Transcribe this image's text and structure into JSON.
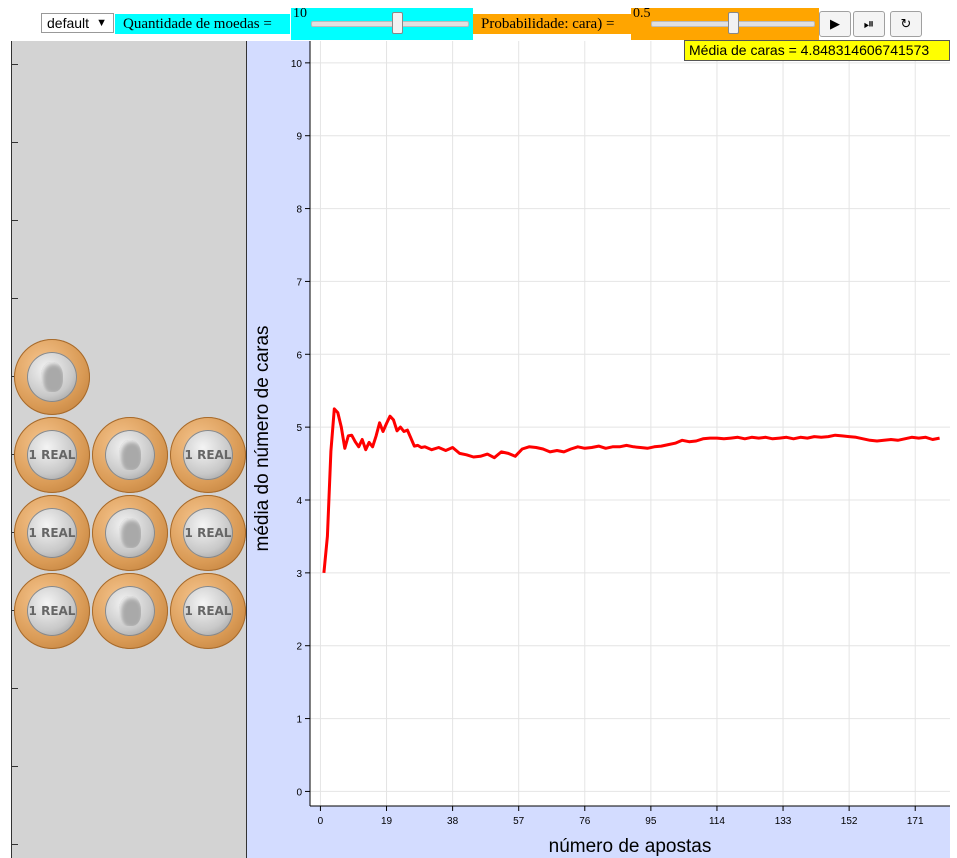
{
  "toolbar": {
    "mode_select": "default",
    "mode_arrow": "▼",
    "qty_label": "Quantidade de moedas =",
    "qty_value": "10",
    "qty_fraction": 0.55,
    "prob_label": "Probabilidade: cara) =",
    "prob_value": "0.5",
    "prob_fraction": 0.5,
    "play_glyph": "▶",
    "step_glyph": "⏯",
    "reset_glyph": "↻"
  },
  "readout": "Média de caras = 4.848314606741573",
  "coins": {
    "faces": [
      "heads",
      "tails",
      "heads",
      "tails",
      "tails",
      "heads",
      "tails",
      "tails",
      "heads",
      "tails"
    ],
    "tails_text": "1 REAL"
  },
  "chart_data": {
    "type": "line",
    "xlabel": "número de apostas",
    "ylabel": "média do número de caras",
    "xlim": [
      -3,
      181
    ],
    "ylim": [
      -0.2,
      10.3
    ],
    "x_ticks": [
      0,
      19,
      38,
      57,
      76,
      95,
      114,
      133,
      152,
      171
    ],
    "y_ticks": [
      0,
      1,
      2,
      3,
      4,
      5,
      6,
      7,
      8,
      9,
      10
    ],
    "grid": true,
    "series": [
      {
        "color": "#ff0000",
        "x": [
          1,
          2,
          3,
          4,
          5,
          6,
          7,
          8,
          9,
          10,
          11,
          12,
          13,
          14,
          15,
          16,
          17,
          18,
          19,
          20,
          21,
          22,
          23,
          24,
          25,
          26,
          27,
          28,
          29,
          30,
          32,
          34,
          36,
          38,
          40,
          42,
          44,
          46,
          48,
          50,
          52,
          54,
          56,
          58,
          60,
          62,
          64,
          66,
          68,
          70,
          72,
          74,
          76,
          78,
          80,
          82,
          84,
          86,
          88,
          90,
          92,
          94,
          96,
          98,
          100,
          102,
          104,
          106,
          108,
          110,
          112,
          114,
          116,
          118,
          120,
          122,
          124,
          126,
          128,
          130,
          132,
          134,
          136,
          138,
          140,
          142,
          144,
          146,
          148,
          150,
          152,
          154,
          156,
          158,
          160,
          162,
          164,
          166,
          168,
          170,
          172,
          174,
          176,
          178
        ],
        "y": [
          3.0,
          3.5,
          4.67,
          5.25,
          5.2,
          5.0,
          4.71,
          4.88,
          4.89,
          4.8,
          4.73,
          4.83,
          4.69,
          4.79,
          4.73,
          4.88,
          5.06,
          4.94,
          5.05,
          5.15,
          5.1,
          4.95,
          5.0,
          4.94,
          4.96,
          4.85,
          4.74,
          4.75,
          4.72,
          4.73,
          4.69,
          4.72,
          4.68,
          4.72,
          4.64,
          4.62,
          4.59,
          4.6,
          4.63,
          4.58,
          4.66,
          4.64,
          4.6,
          4.7,
          4.73,
          4.72,
          4.7,
          4.66,
          4.68,
          4.66,
          4.7,
          4.73,
          4.71,
          4.72,
          4.74,
          4.71,
          4.73,
          4.73,
          4.75,
          4.73,
          4.72,
          4.71,
          4.73,
          4.74,
          4.76,
          4.78,
          4.82,
          4.8,
          4.81,
          4.84,
          4.85,
          4.85,
          4.84,
          4.85,
          4.86,
          4.84,
          4.86,
          4.85,
          4.86,
          4.84,
          4.85,
          4.86,
          4.84,
          4.86,
          4.85,
          4.87,
          4.86,
          4.87,
          4.89,
          4.88,
          4.87,
          4.86,
          4.84,
          4.82,
          4.81,
          4.82,
          4.83,
          4.82,
          4.84,
          4.86,
          4.85,
          4.86,
          4.83,
          4.85
        ]
      }
    ]
  }
}
